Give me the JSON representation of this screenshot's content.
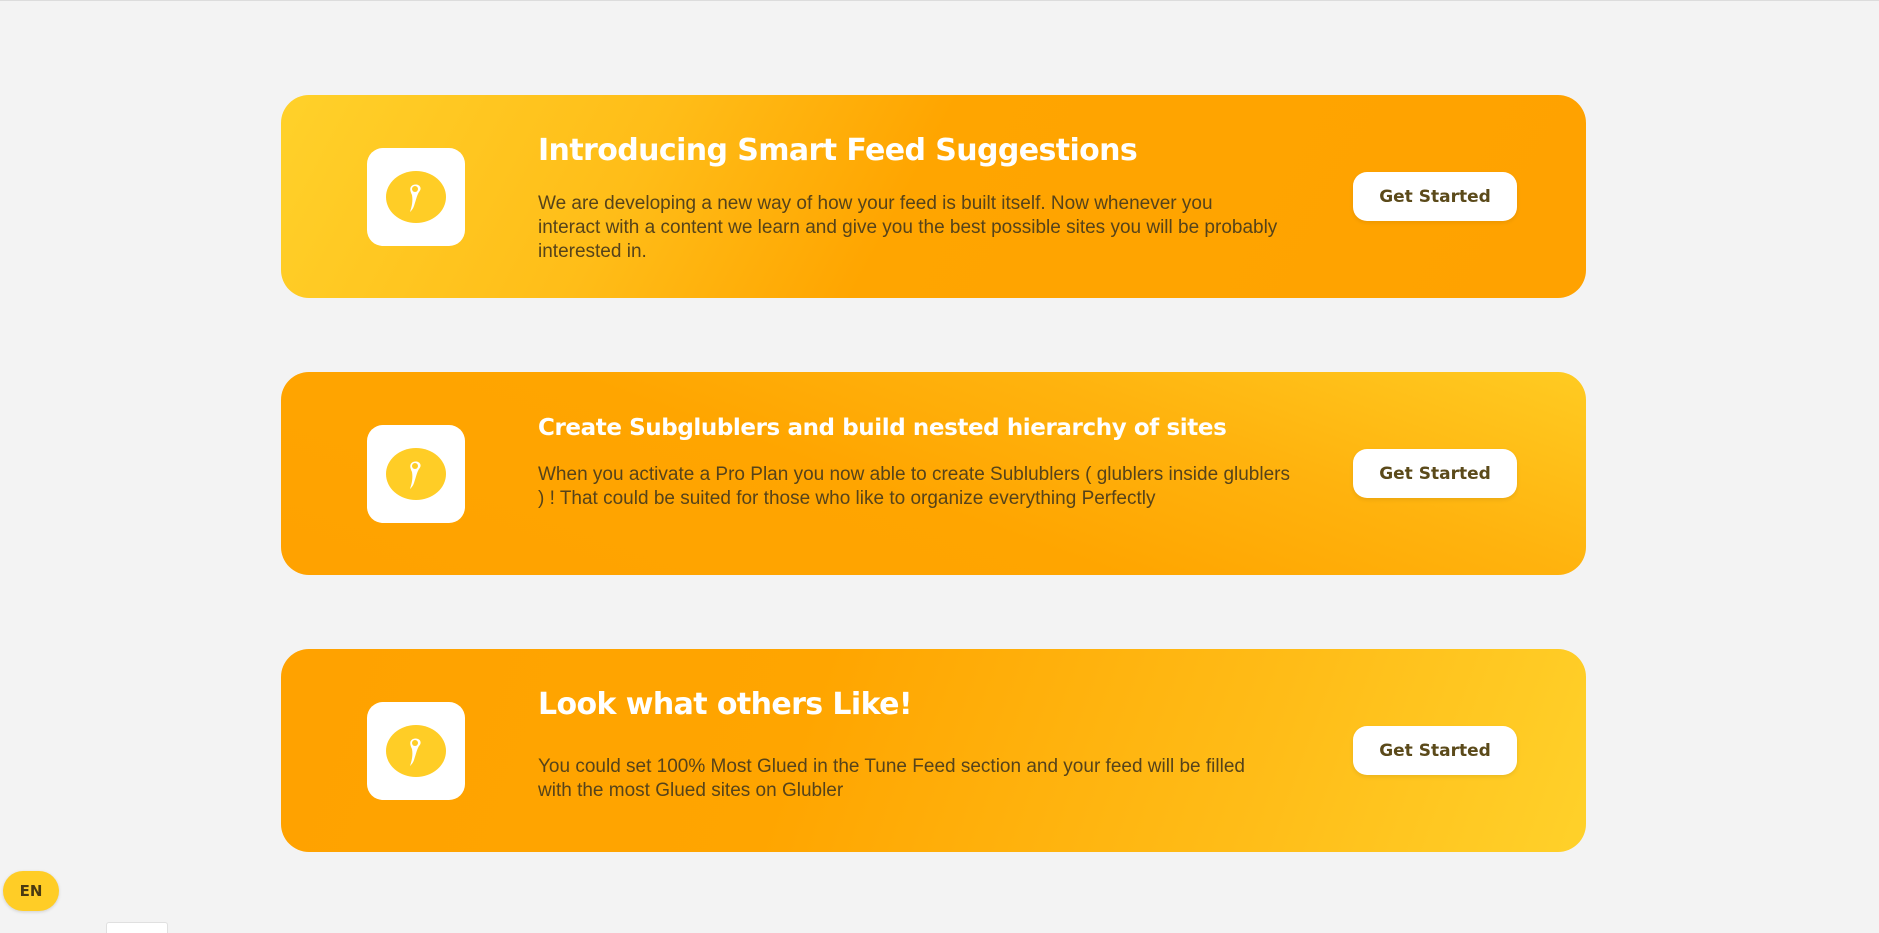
{
  "colors": {
    "page_background": "#f3f3f3",
    "accent_yellow": "#ffd12a",
    "accent_orange": "#ffa200",
    "title_white": "#ffffff",
    "body_text": "#56431a",
    "button_text": "#5b4a1a"
  },
  "cards": [
    {
      "icon": "glubler-logo-icon",
      "title": "Introducing Smart Feed Suggestions",
      "text": "We are developing a new way of how your feed is built itself. Now whenever you interact with a content we learn and give you the best possible sites you will be probably interested in.",
      "button_label": "Get Started"
    },
    {
      "icon": "glubler-logo-icon",
      "title": "Create Subglublers and build nested hierarchy of sites",
      "text": "When you activate a Pro Plan you now able to create Sublublers ( glublers inside glublers ) ! That could be suited for those who like to organize everything Perfectly",
      "button_label": "Get Started"
    },
    {
      "icon": "glubler-logo-icon",
      "title": "Look what others Like!",
      "text": "You could set 100% Most Glued in the Tune Feed section and your feed will be filled with the most Glued sites on Glubler",
      "button_label": "Get Started"
    }
  ],
  "language": {
    "current": "EN"
  }
}
